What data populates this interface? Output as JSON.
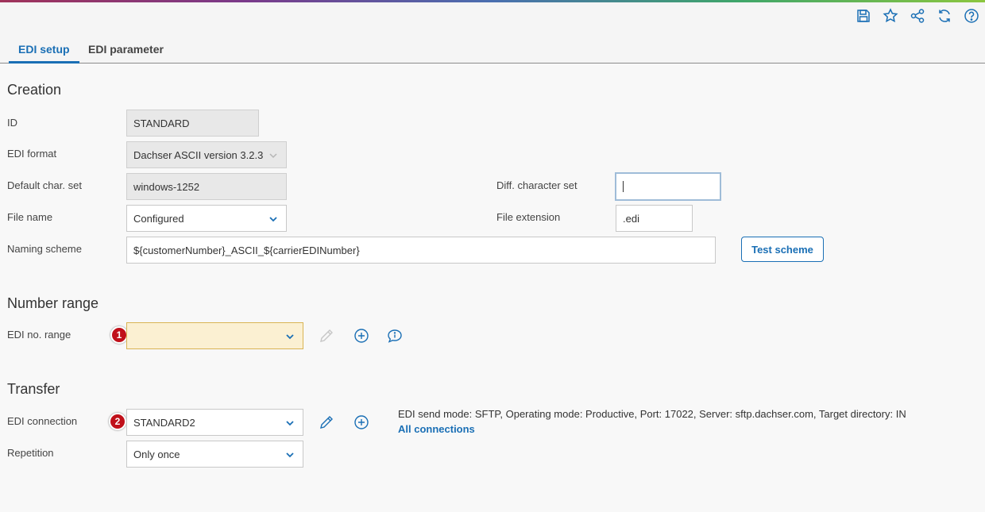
{
  "toolbar": {
    "icons": [
      "save-icon",
      "star-icon",
      "share-icon",
      "refresh-icon",
      "help-icon"
    ]
  },
  "tabs": [
    {
      "label": "EDI setup",
      "active": true
    },
    {
      "label": "EDI parameter",
      "active": false
    }
  ],
  "creation": {
    "title": "Creation",
    "id": {
      "label": "ID",
      "value": "STANDARD"
    },
    "edi_format": {
      "label": "EDI format",
      "value": "Dachser ASCII version 3.2.3"
    },
    "default_charset": {
      "label": "Default char. set",
      "value": "windows-1252"
    },
    "diff_charset": {
      "label": "Diff. character set",
      "value": ""
    },
    "file_name": {
      "label": "File name",
      "value": "Configured"
    },
    "file_extension": {
      "label": "File extension",
      "value": ".edi"
    },
    "naming_scheme": {
      "label": "Naming scheme",
      "value": "${customerNumber}_ASCII_${carrierEDINumber}"
    },
    "test_scheme_label": "Test scheme"
  },
  "number_range": {
    "title": "Number range",
    "edi_no_range": {
      "label": "EDI no. range",
      "value": "",
      "badge": "1"
    }
  },
  "transfer": {
    "title": "Transfer",
    "edi_connection": {
      "label": "EDI connection",
      "value": "STANDARD2",
      "badge": "2"
    },
    "repetition": {
      "label": "Repetition",
      "value": "Only once"
    },
    "connection_info": "EDI send mode: SFTP, Operating mode: Productive, Port: 17022, Server: sftp.dachser.com, Target directory: IN",
    "all_connections_label": "All connections"
  },
  "colors": {
    "accent": "#1a6fb5",
    "badge": "#c0101a",
    "warning_bg": "#fbf0d2"
  }
}
